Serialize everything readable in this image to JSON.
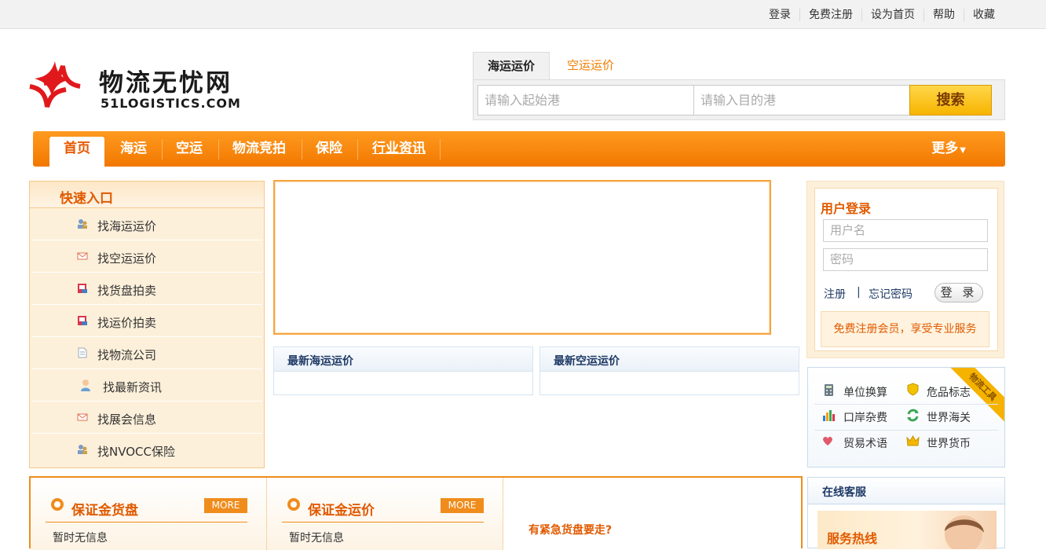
{
  "top_links": [
    "登录",
    "免费注册",
    "设为首页",
    "帮助",
    "收藏"
  ],
  "logo": {
    "cn": "物流无忧网",
    "en": "51LOGISTICS.COM"
  },
  "search": {
    "tabs": [
      "海运运价",
      "空运运价"
    ],
    "from_placeholder": "请输入起始港",
    "to_placeholder": "请输入目的港",
    "button": "搜索"
  },
  "nav": {
    "items": [
      "首页",
      "海运",
      "空运",
      "物流竞拍",
      "保险",
      "行业资讯"
    ],
    "more": "更多"
  },
  "quick": {
    "title": "快速入口",
    "items": [
      "找海运运价",
      "找空运运价",
      "找货盘拍卖",
      "找运价拍卖",
      "找物流公司",
      "找最新资讯",
      "找展会信息",
      "找NVOCC保险"
    ]
  },
  "prices": {
    "sea_title": "最新海运运价",
    "air_title": "最新空运运价"
  },
  "login": {
    "title": "用户登录",
    "username_placeholder": "用户名",
    "password_placeholder": "密码",
    "register": "注册",
    "separator": "|",
    "forgot": "忘记密码",
    "button": "登 录",
    "promo": "免费注册会员，享受专业服务"
  },
  "tools": {
    "ribbon": "物流工具",
    "items": [
      "单位换算",
      "危品标志",
      "口岸杂费",
      "世界海关",
      "贸易术语",
      "世界货币"
    ]
  },
  "guarantee": {
    "cargo_title": "保证金货盘",
    "freight_title": "保证金运价",
    "more": "MORE",
    "empty": "暂时无信息",
    "ask": "有紧急货盘要走?"
  },
  "service": {
    "title": "在线客服",
    "hotline": "服务热线"
  },
  "colors": {
    "accent": "#f27800",
    "title_orange": "#e05a00",
    "nav_blue": "#1f3a66"
  }
}
